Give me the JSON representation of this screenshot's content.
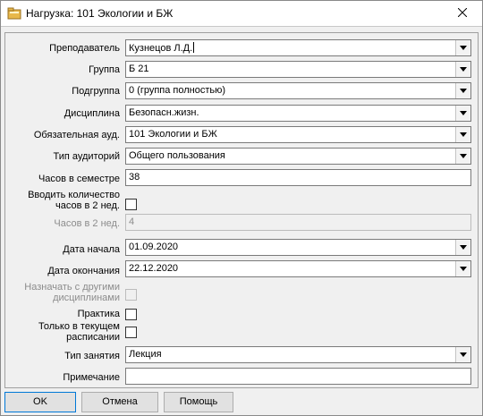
{
  "window": {
    "title": "Нагрузка: 101  Экологии и БЖ",
    "icon": "folder-icon",
    "close_icon": "close-icon"
  },
  "form": {
    "teacher": {
      "label": "Преподаватель",
      "value": "Кузнецов Л.Д."
    },
    "group": {
      "label": "Группа",
      "value": "Б 21"
    },
    "subgroup": {
      "label": "Подгруппа",
      "value": "0 (группа полностью)"
    },
    "discipline": {
      "label": "Дисциплина",
      "value": "Безопасн.жизн."
    },
    "room": {
      "label": "Обязательная ауд.",
      "value": "101  Экологии и БЖ"
    },
    "room_type": {
      "label": "Тип аудиторий",
      "value": "Общего пользования"
    },
    "hours_semester": {
      "label": "Часов в семестре",
      "value": "38"
    },
    "enter_hours": {
      "label": "Вводить количество часов в 2 нед.",
      "checked": false
    },
    "hours_2weeks": {
      "label": "Часов в 2 нед.",
      "value": "4"
    },
    "start_date": {
      "label": "Дата начала",
      "value": "01.09.2020"
    },
    "end_date": {
      "label": "Дата окончания",
      "value": "22.12.2020"
    },
    "assign_with_others": {
      "label": "Назначать с другими дисциплинами",
      "checked": false
    },
    "practice": {
      "label": "Практика",
      "checked": false
    },
    "current_only": {
      "label": "Только в текущем расписании",
      "checked": false
    },
    "lesson_type": {
      "label": "Тип занятия",
      "value": "Лекция"
    },
    "note": {
      "label": "Примечание",
      "value": ""
    }
  },
  "buttons": {
    "ok": "OK",
    "cancel": "Отмена",
    "help": "Помощь"
  }
}
